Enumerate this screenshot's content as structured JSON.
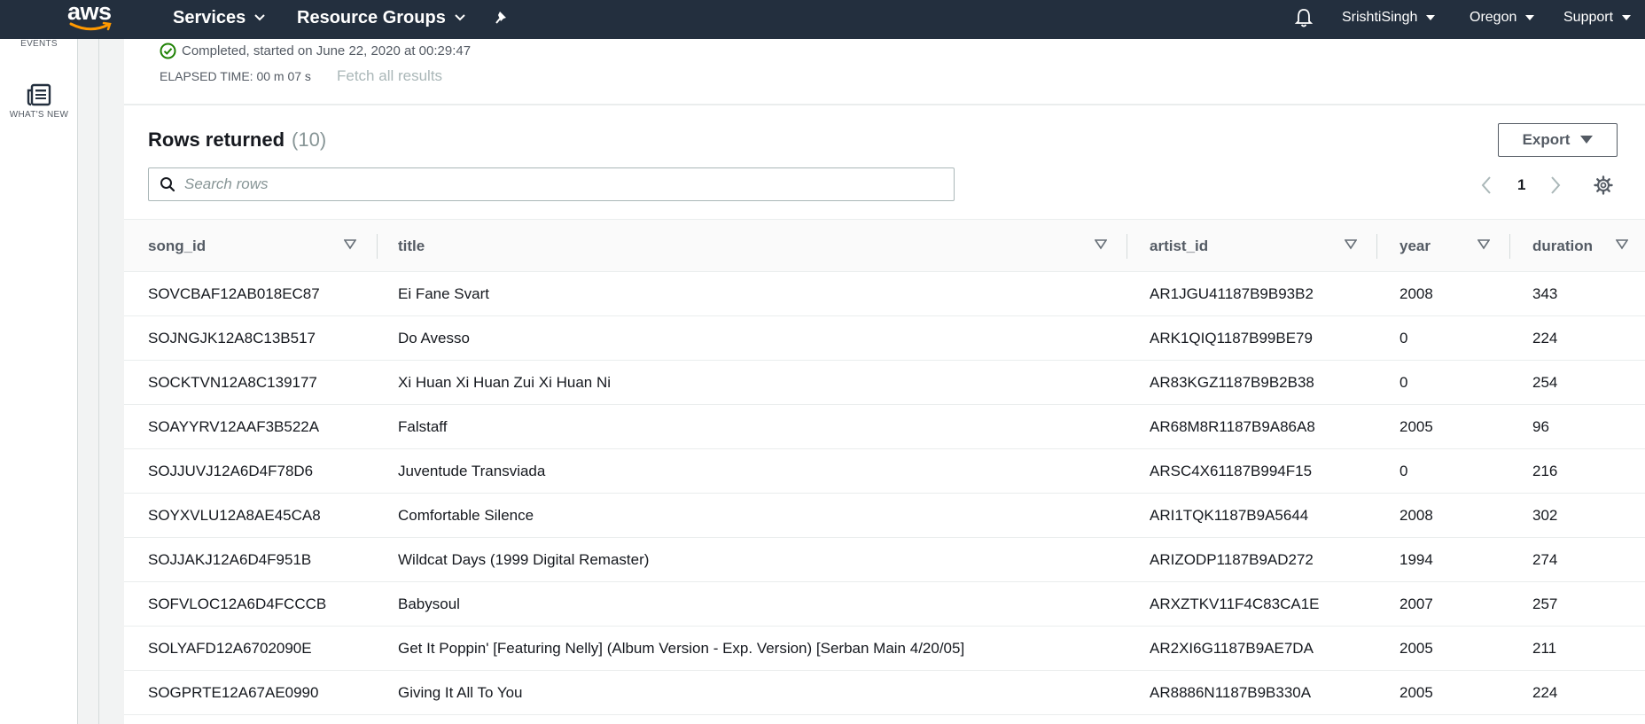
{
  "nav": {
    "logo_text": "aws",
    "services_label": "Services",
    "resource_groups_label": "Resource Groups",
    "pin_icon": "pin-icon",
    "bell_icon": "bell-icon",
    "user_label": "SrishtiSingh",
    "region_label": "Oregon",
    "support_label": "Support"
  },
  "rail": {
    "events_label": "EVENTS",
    "whats_new_label": "WHAT'S NEW",
    "whats_new_icon": "newspaper-icon"
  },
  "status": {
    "icon": "check-circle-icon",
    "icon_color": "#1d8102",
    "text": "Completed, started on June 22, 2020 at 00:29:47",
    "elapsed": "ELAPSED TIME: 00 m 07 s",
    "fetch_label": "Fetch all results"
  },
  "results": {
    "title": "Rows returned",
    "count": "(10)",
    "export_label": "Export",
    "search_placeholder": "Search rows",
    "page": "1",
    "columns": [
      "song_id",
      "title",
      "artist_id",
      "year",
      "duration"
    ],
    "rows": [
      [
        "SOVCBAF12AB018EC87",
        "Ei Fane Svart",
        "AR1JGU41187B9B93B2",
        "2008",
        "343"
      ],
      [
        "SOJNGJK12A8C13B517",
        "Do Avesso",
        "ARK1QIQ1187B99BE79",
        "0",
        "224"
      ],
      [
        "SOCKTVN12A8C139177",
        "Xi Huan Xi Huan Zui Xi Huan Ni",
        "AR83KGZ1187B9B2B38",
        "0",
        "254"
      ],
      [
        "SOAYYRV12AAF3B522A",
        "Falstaff",
        "AR68M8R1187B9A86A8",
        "2005",
        "96"
      ],
      [
        "SOJJUVJ12A6D4F78D6",
        "Juventude Transviada",
        "ARSC4X61187B994F15",
        "0",
        "216"
      ],
      [
        "SOYXVLU12A8AE45CA8",
        "Comfortable Silence",
        "ARI1TQK1187B9A5644",
        "2008",
        "302"
      ],
      [
        "SOJJAKJ12A6D4F951B",
        "Wildcat Days (1999 Digital Remaster)",
        "ARIZODP1187B9AD272",
        "1994",
        "274"
      ],
      [
        "SOFVLOC12A6D4FCCCB",
        "Babysoul",
        "ARXZTKV11F4C83CA1E",
        "2007",
        "257"
      ],
      [
        "SOLYAFD12A6702090E",
        "Get It Poppin' [Featuring Nelly] (Album Version - Exp. Version) [Serban Main 4/20/05]",
        "AR2XI6G1187B9AE7DA",
        "2005",
        "211"
      ],
      [
        "SOGPRTE12A67AE0990",
        "Giving It All To You",
        "AR8886N1187B9B330A",
        "2005",
        "224"
      ]
    ]
  }
}
